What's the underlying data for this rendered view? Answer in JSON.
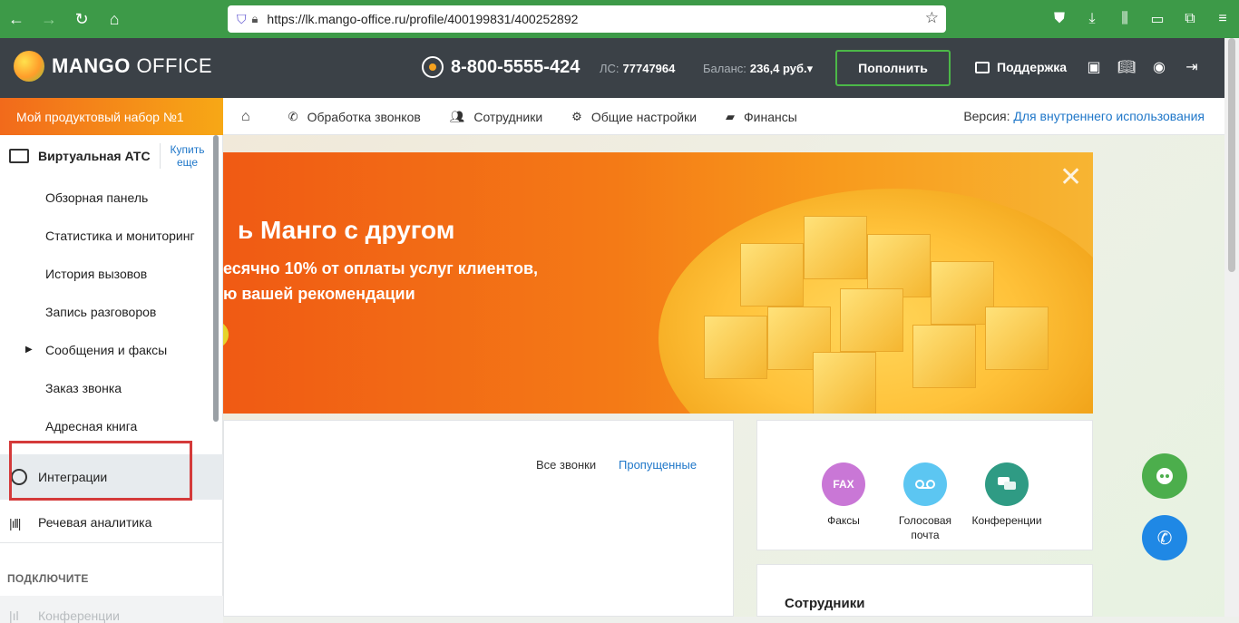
{
  "browser": {
    "url": "https://lk.mango-office.ru/profile/400199831/400252892",
    "nav_icons": [
      "back-icon",
      "forward-icon",
      "reload-icon",
      "home-icon"
    ],
    "right_icons": [
      "pocket-icon",
      "download-icon",
      "library-icon",
      "sidebar-icon",
      "extensions-icon",
      "menu-icon"
    ]
  },
  "header": {
    "logo_bold": "MANGO",
    "logo_light": " OFFICE",
    "phone": "8-800-5555-424",
    "account_label": "ЛС:",
    "account_number": "77747964",
    "balance_label": "Баланс:",
    "balance_value": "236,4 руб.▾",
    "topup_label": "Пополнить",
    "support_label": "Поддержка"
  },
  "nav": {
    "product_set": "Мой продуктовый набор №1",
    "items": [
      {
        "label": "Обработка звонков",
        "icon": "phone-icon"
      },
      {
        "label": "Сотрудники",
        "icon": "users-icon"
      },
      {
        "label": "Общие настройки",
        "icon": "gear-icon"
      },
      {
        "label": "Финансы",
        "icon": "wallet-icon"
      }
    ],
    "version_label": "Версия:",
    "version_value": "Для внутреннего использования"
  },
  "sidebar": {
    "title": "Виртуальная АТС",
    "buy_more": "Купить еще",
    "items": [
      "Обзорная панель",
      "Статистика и мониторинг",
      "История вызовов",
      "Запись разговоров",
      "Сообщения и факсы",
      "Заказ звонка",
      "Адресная книга"
    ],
    "integrations": "Интеграции",
    "speech_analytics": "Речевая аналитика",
    "connect_heading": "ПОДКЛЮЧИТЕ",
    "faded_item": "Конференции"
  },
  "banner": {
    "title": "ь Манго с другом",
    "subtitle_line1": "есячно 10% от оплаты услуг клиентов,",
    "subtitle_line2": "ю вашей рекомендации",
    "close": "✕"
  },
  "calls_card": {
    "all_calls": "Все звонки",
    "missed": "Пропущенные"
  },
  "services": [
    {
      "label": "Факсы",
      "badge": "FAX",
      "color": "#c977d6"
    },
    {
      "label": "Голосовая почта",
      "badge": "",
      "color": "#5cc6f2"
    },
    {
      "label": "Конференции",
      "badge": "",
      "color": "#2f9b84"
    }
  ],
  "staff_card": {
    "title": "Сотрудники"
  },
  "colors": {
    "brand_dark": "#3b4147",
    "accent_green": "#4cb848",
    "link_blue": "#1f77c9",
    "browser_green": "#3d9a48"
  }
}
